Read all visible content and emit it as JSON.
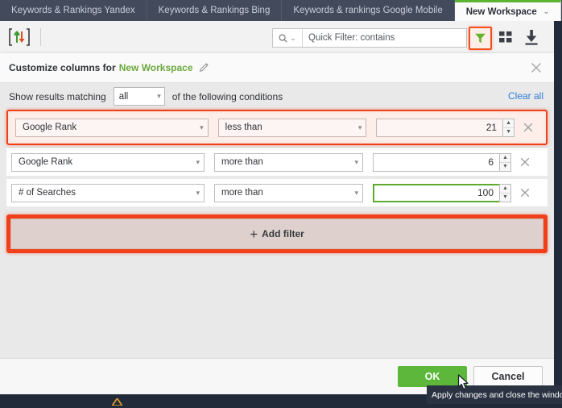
{
  "tabs": [
    {
      "label": "Keywords & Rankings Yandex",
      "active": false
    },
    {
      "label": "Keywords & Rankings Bing",
      "active": false
    },
    {
      "label": "Keywords & rankings Google Mobile",
      "active": false
    },
    {
      "label": "New Workspace",
      "active": true
    }
  ],
  "tab_controls": {
    "add": "+",
    "prev": "‹",
    "next": "›",
    "active_caret": "⌄"
  },
  "toolbar": {
    "sort_icon": "sort-import-export-icon",
    "search_placeholder": "Quick Filter: contains",
    "search_value": "",
    "search_icon": "magnifier-icon",
    "search_caret": "⌄",
    "filter_icon": "funnel-filter-icon",
    "grid_icon": "grid-view-icon",
    "download_icon": "download-icon"
  },
  "dialog": {
    "title_prefix": "Customize columns for",
    "workspace_name": "New Workspace",
    "edit_icon": "pencil-edit-icon",
    "close_icon": "close-x-icon",
    "match_prefix": "Show results matching",
    "match_value": "all",
    "match_suffix": "of the following conditions",
    "clear_all": "Clear all",
    "add_filter": "Add filter",
    "add_filter_plus": "+",
    "ok": "OK",
    "cancel": "Cancel"
  },
  "filters": [
    {
      "field": "Google Rank",
      "operator": "less than",
      "value": "21",
      "highlighted": true,
      "focused": false,
      "remove_icon": "remove-filter-x-icon"
    },
    {
      "field": "Google Rank",
      "operator": "more than",
      "value": "6",
      "highlighted": false,
      "focused": false,
      "remove_icon": "remove-filter-x-icon"
    },
    {
      "field": "# of Searches",
      "operator": "more than",
      "value": "100",
      "highlighted": false,
      "focused": true,
      "remove_icon": "remove-filter-x-icon"
    }
  ],
  "tooltip": {
    "text": "Apply changes and close the window"
  },
  "status_bar": {
    "warning_icon": "warning-triangle-icon"
  },
  "colors": {
    "tabbar_bg": "#434a5c",
    "accent_green": "#5cb73b",
    "highlight_orange": "#f0401a",
    "link_blue": "#2e7bd6",
    "workspace_green": "#6aa83d",
    "tooltip_bg": "#2b3343",
    "page_dark": "#222b3a"
  }
}
